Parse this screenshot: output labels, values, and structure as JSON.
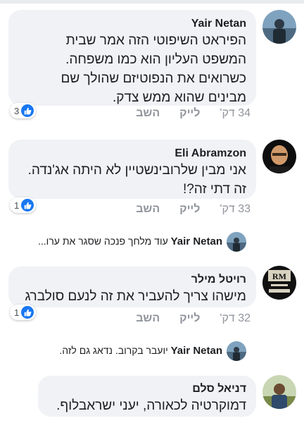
{
  "comments": [
    {
      "author": "Yair Netan",
      "lines": [
        "הפיראט השיפוטי הזה אמר שבית",
        "המשפט העליון הוא כמו משפחה.",
        "כשרואים את הנפוטיזם שהולך שם",
        "מבינים שהוא ממש צדק."
      ],
      "time": "34 דק'",
      "like_label": "לייק",
      "reply_label": "השב",
      "reactions": "3"
    },
    {
      "author": "Eli Abramzon",
      "lines": [
        "אני מבין שלרובינשטיין לא היתה אג'נדה.",
        "זה דתי זה?!"
      ],
      "time": "33 דק'",
      "like_label": "לייק",
      "reply_label": "השב",
      "reactions": "1"
    },
    {
      "author": "רויטל מילר",
      "lines": [
        "מישהו צריך להעביר את זה לנעם סולברג"
      ],
      "time": "32 דק'",
      "like_label": "לייק",
      "reply_label": "השב",
      "reactions": "1"
    },
    {
      "author": "דניאל סלם",
      "lines": [
        "דמוקרטיה לכאורה, יעני ישראבלוף."
      ]
    }
  ],
  "replies": [
    {
      "author": "Yair Netan",
      "text": "עוד מלחך פנכה שסגר את ערו..."
    },
    {
      "author": "Yair Netan",
      "text": "יועבר בקרוב. נדאג גם לזה."
    }
  ],
  "avatar_logo_text": "RM",
  "colors": {
    "like_blue": "#1877f2",
    "bubble_bg": "#f0f2f5",
    "meta_gray": "#90949c"
  }
}
